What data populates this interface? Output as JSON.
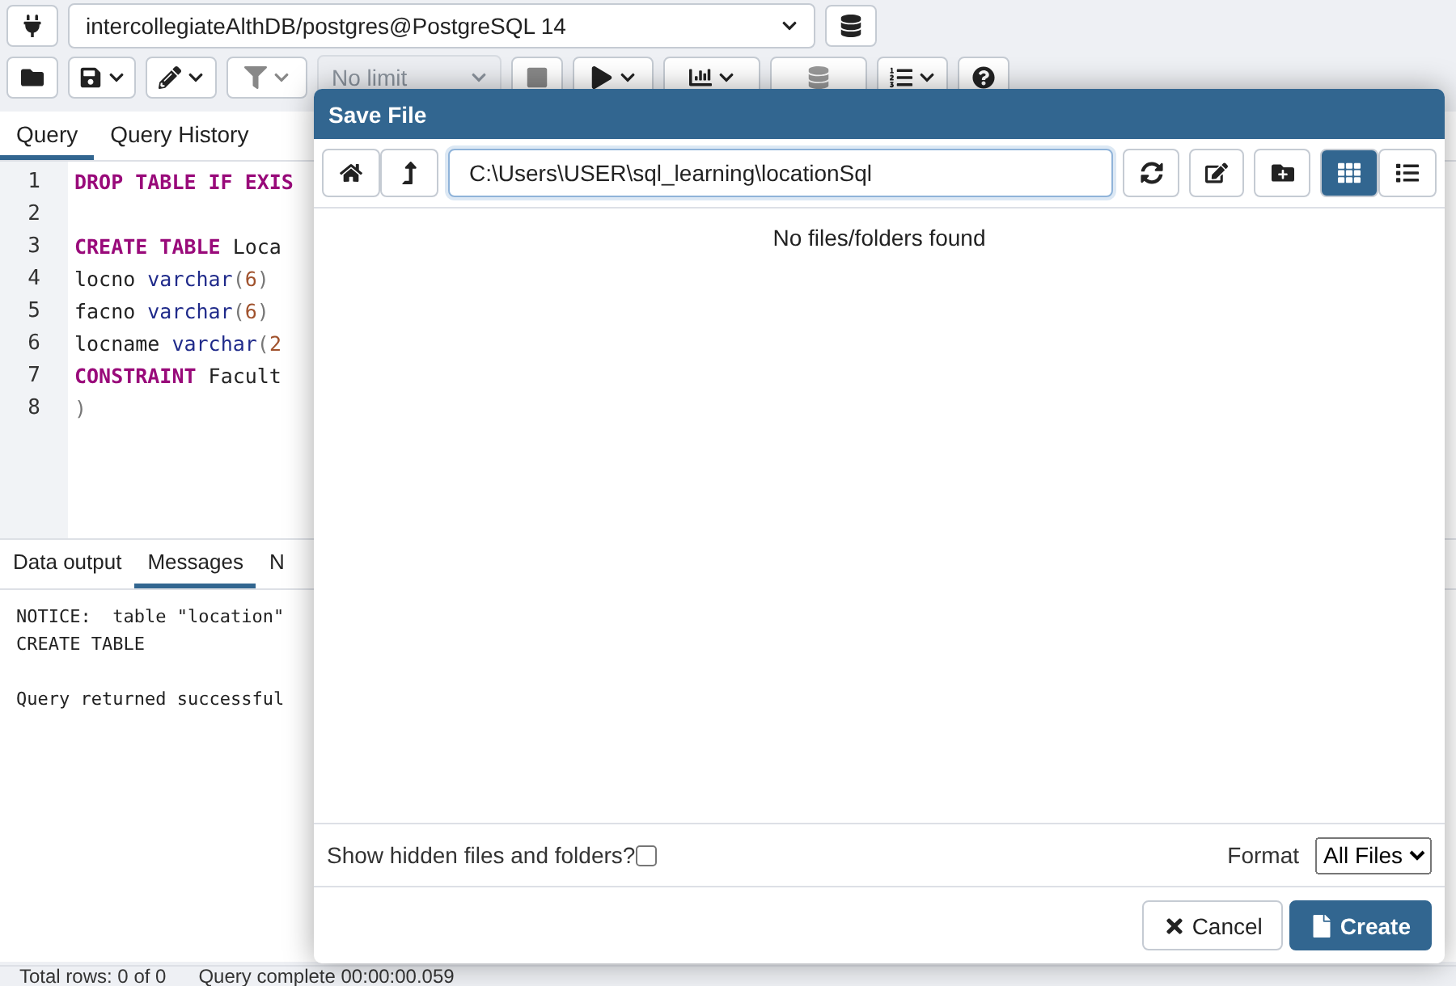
{
  "connection": {
    "label": "intercollegiateAlthDB/postgres@PostgreSQL 14"
  },
  "toolbar": {
    "limit": "No limit"
  },
  "editor_tabs": [
    {
      "label": "Query",
      "selected": true
    },
    {
      "label": "Query History",
      "selected": false
    }
  ],
  "code_lines": [
    {
      "number": "1",
      "tokens": [
        {
          "text": "DROP TABLE IF EXIS",
          "kind": "keyword"
        }
      ]
    },
    {
      "number": "2"
    },
    {
      "number": "3",
      "tokens": [
        {
          "text": "CREATE TABLE ",
          "kind": "keyword"
        },
        {
          "text": "Loca",
          "kind": "plain"
        }
      ]
    },
    {
      "number": "4",
      "tokens": [
        {
          "text": "locno ",
          "kind": "plain"
        },
        {
          "text": "varchar",
          "kind": "type"
        },
        {
          "text": "(",
          "kind": "punct"
        },
        {
          "text": "6",
          "kind": "number"
        },
        {
          "text": ")",
          "kind": "punct"
        }
      ]
    },
    {
      "number": "5",
      "tokens": [
        {
          "text": "facno ",
          "kind": "plain"
        },
        {
          "text": "varchar",
          "kind": "type"
        },
        {
          "text": "(",
          "kind": "punct"
        },
        {
          "text": "6",
          "kind": "number"
        },
        {
          "text": ")",
          "kind": "punct"
        }
      ]
    },
    {
      "number": "6",
      "tokens": [
        {
          "text": "locname ",
          "kind": "plain"
        },
        {
          "text": "varchar",
          "kind": "type"
        },
        {
          "text": "(",
          "kind": "punct"
        },
        {
          "text": "2",
          "kind": "number"
        }
      ]
    },
    {
      "number": "7",
      "tokens": [
        {
          "text": "CONSTRAINT ",
          "kind": "keyword"
        },
        {
          "text": "Facult",
          "kind": "plain"
        }
      ]
    },
    {
      "number": "8",
      "tokens": [
        {
          "text": ")",
          "kind": "punct"
        }
      ]
    }
  ],
  "output_tabs": [
    {
      "label": "Data output",
      "selected": false
    },
    {
      "label": "Messages",
      "selected": true
    },
    {
      "label": "N",
      "selected": false
    }
  ],
  "message_groups": [
    [
      "NOTICE:  table \"location\"",
      "CREATE TABLE"
    ],
    [
      "Query returned successful"
    ]
  ],
  "status_bar": [
    "Total rows: 0 of 0",
    "Query complete 00:00:00.059"
  ],
  "dialog": {
    "title": "Save File",
    "path": "C:\\Users\\USER\\sql_learning\\locationSql",
    "view_modes": [
      {
        "kind": "grid",
        "selected": true
      },
      {
        "kind": "list",
        "selected": false
      }
    ],
    "empty_message": "No files/folders found",
    "show_hidden": {
      "label": "Show hidden files and folders?",
      "checked": false
    },
    "format": {
      "label": "Format",
      "value": "All Files"
    },
    "buttons": [
      {
        "label": "Cancel",
        "kind": "secondary"
      },
      {
        "label": "Create",
        "kind": "primary"
      }
    ]
  }
}
